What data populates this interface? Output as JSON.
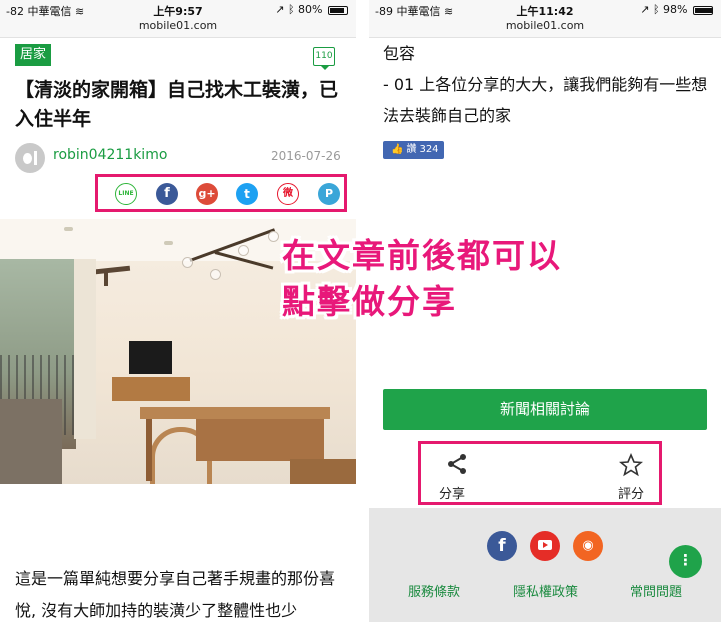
{
  "left_phone": {
    "status": {
      "carrier": "-82 中華電信",
      "time": "上午9:57",
      "battery": "80%",
      "battery_level": 0.8
    },
    "url": "mobile01.com",
    "category": "居家",
    "comment_count": "110",
    "title": "【清淡的家開箱】自己找木工裝潢，已入住半年",
    "author": "robin04211kimo",
    "date": "2016-07-26",
    "share_icons": [
      "line-icon",
      "facebook-icon",
      "google-plus-icon",
      "twitter-icon",
      "weibo-icon",
      "plurk-icon"
    ],
    "share_glyphs": {
      "line": "LINE",
      "facebook": "f",
      "google_plus": "g+",
      "twitter": "t",
      "weibo": "微",
      "plurk": "P"
    },
    "body_text": "這是一篇單純想要分享自己著手規畫的那份喜悅, 沒有大師加持的裝潢少了整體性也少"
  },
  "callout": "在文章前後都可以點擊做分享",
  "right_phone": {
    "status": {
      "carrier": "-89 中華電信",
      "time": "上午11:42",
      "battery": "98%",
      "battery_level": 0.98
    },
    "url": "mobile01.com",
    "body_text": "包容\n- 01 上各位分享的大大，讓我們能夠有一些想法去裝飾自己的家",
    "like": {
      "label": "讚",
      "count": "324"
    },
    "news_button": "新聞相關討論",
    "actions": {
      "share": "分享",
      "rate": "評分"
    },
    "social_icons": [
      "facebook-icon",
      "youtube-icon",
      "rss-icon"
    ],
    "footer_links": [
      "服務條款",
      "隱私權政策",
      "常問問題"
    ],
    "fab_glyph": "⋮"
  },
  "colors": {
    "brand_green": "#1a9c42",
    "highlight_magenta": "#e5196e",
    "callout_pink": "#e8187a",
    "facebook_blue": "#3b5998"
  }
}
